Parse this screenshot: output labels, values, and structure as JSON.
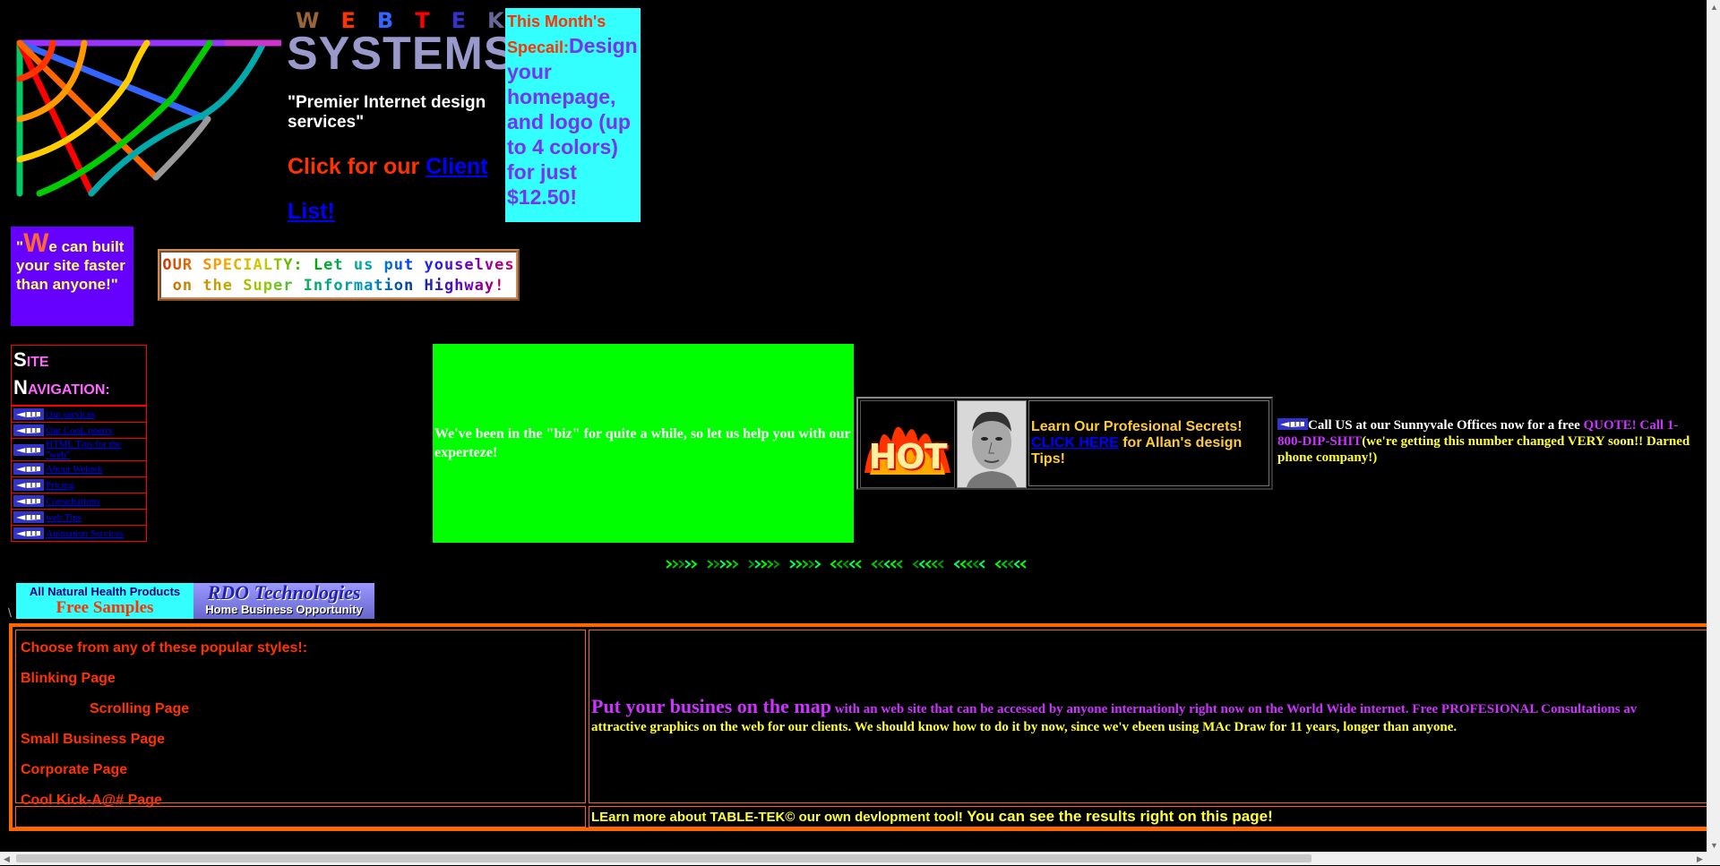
{
  "header": {
    "logo_letters": [
      "W",
      "E",
      "B",
      "T",
      "E",
      "K"
    ],
    "logo_letter_colors": [
      "#996633",
      "#ff3300",
      "#3366ff",
      "#ff0000",
      "#3333cc",
      "#666699"
    ],
    "systems": "SYSTEMS",
    "tagline": "\"Premier Internet design services\"",
    "client_prefix": "Click for our ",
    "client_link": "Client List!"
  },
  "special": {
    "lead": "This Month's Specail:",
    "body": "Design your homepage, and logo (up to 4 colors) for just $12.50!"
  },
  "quote": {
    "open": "\"",
    "big_letter": "W",
    "rest": "e can built your site faster than anyone!\""
  },
  "specialty": {
    "line1": "OUR SPECIALTY: Let us put youselves",
    "line2": "on the Super Information Highway!"
  },
  "site_nav": {
    "title_s": "S",
    "title_ite": "ITE",
    "title_n": "N",
    "title_avigation": "AVIGATION:",
    "items": [
      {
        "label": "Our services"
      },
      {
        "label": "Our CooL poetry"
      },
      {
        "label": "HTML Tips for the \"web\""
      },
      {
        "label": "About Webtek"
      },
      {
        "label": "Pricing"
      },
      {
        "label": "Consultations"
      },
      {
        "label": "web Tips"
      },
      {
        "label": "Animation Services"
      }
    ]
  },
  "green_box": {
    "text": "We've been in the \"biz\" for quite a while, so let us help you with our experteze!"
  },
  "hot": {
    "hot_word": "HOT",
    "text_before": "Learn Our Profesional Secrets!",
    "link": "CLICK HERE",
    "text_after": " for Allan's design Tips!"
  },
  "call_us": {
    "part1": "Call US at our Sunnyvale Offices now for a free ",
    "quote_link": "QUOTE! Call 1-800-DIP-SHIT",
    "part2": "(we're getting this number changed VERY soon!! Darned phone company!)"
  },
  "ad": {
    "left_line1": "All Natural Health Products",
    "left_line2": "Free Samples",
    "right_line1": "RDO Technologies",
    "right_line2": "Home Business Opportunity"
  },
  "styles": {
    "heading": "Choose from any of these popular styles!:",
    "items": [
      "Blinking Page",
      "Scrolling Page",
      "Small Business Page",
      "Corporate Page",
      "Cool Kick-A@# Page"
    ]
  },
  "map_cell": {
    "headline": "Put your busines on the map",
    "magenta_text": " with an web site that can be accessed by anyone internationly right now on the World Wide internet. Free PROFESIONAL Consultations av",
    "yellow_text": "attractive graphics on the web for our clients. We should know how to do it by now, since we'v ebeen using MAc Draw for 11 years, longer than anyone."
  },
  "tabletek": {
    "part1": "LEarn more about TABLE-TEK© our own devlopment tool! ",
    "part2": "You can see the results right on this page!"
  },
  "misc": {
    "backslash": "\\"
  },
  "colors": {
    "background": "#000000",
    "green_box": "#00ff00",
    "special_box": "#33ffff",
    "quote_box": "#6600ff",
    "table_border": "#ff6600"
  }
}
